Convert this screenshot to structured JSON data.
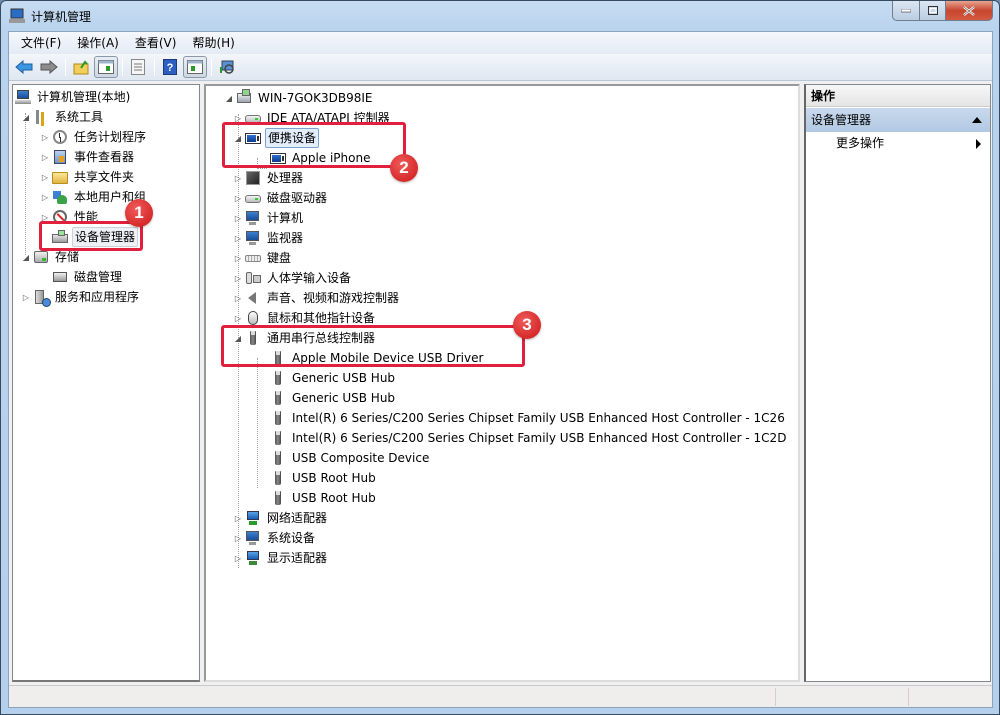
{
  "window": {
    "title": "计算机管理",
    "controls": {
      "minimize": "minimize",
      "maximize": "maximize",
      "close": "close"
    }
  },
  "menubar": {
    "items": [
      "文件(F)",
      "操作(A)",
      "查看(V)",
      "帮助(H)"
    ]
  },
  "toolbar": {
    "buttons": [
      {
        "icon": "back-arrow-icon"
      },
      {
        "icon": "forward-arrow-icon"
      },
      {
        "icon": "up-folder-icon"
      },
      {
        "icon": "show-hide-console-tree-icon",
        "pressed": true
      },
      {
        "icon": "properties-icon"
      },
      {
        "icon": "help-icon"
      },
      {
        "icon": "show-hide-action-pane-icon",
        "pressed": true
      },
      {
        "icon": "scan-hardware-icon"
      }
    ]
  },
  "left_tree": {
    "root": "计算机管理(本地)",
    "system_tools": "系统工具",
    "system_tools_children": [
      "任务计划程序",
      "事件查看器",
      "共享文件夹",
      "本地用户和组",
      "性能",
      "设备管理器"
    ],
    "storage": "存储",
    "storage_children": [
      "磁盘管理"
    ],
    "services": "服务和应用程序",
    "selected": "设备管理器"
  },
  "device_tree": {
    "root": "WIN-7GOK3DB98IE",
    "categories": [
      {
        "label": "IDE ATA/ATAPI 控制器",
        "expanded": false
      },
      {
        "label": "便携设备",
        "expanded": true,
        "children": [
          "Apple iPhone"
        ]
      },
      {
        "label": "处理器",
        "expanded": false
      },
      {
        "label": "磁盘驱动器",
        "expanded": false
      },
      {
        "label": "计算机",
        "expanded": false
      },
      {
        "label": "监视器",
        "expanded": false
      },
      {
        "label": "键盘",
        "expanded": false
      },
      {
        "label": "人体学输入设备",
        "expanded": false
      },
      {
        "label": "声音、视频和游戏控制器",
        "expanded": false
      },
      {
        "label": "鼠标和其他指针设备",
        "expanded": false
      },
      {
        "label": "通用串行总线控制器",
        "expanded": true,
        "children": [
          "Apple Mobile Device USB Driver",
          "Generic USB Hub",
          "Generic USB Hub",
          "Intel(R) 6 Series/C200 Series Chipset Family USB Enhanced Host Controller - 1C26",
          "Intel(R) 6 Series/C200 Series Chipset Family USB Enhanced Host Controller - 1C2D",
          "USB Composite Device",
          "USB Root Hub",
          "USB Root Hub"
        ]
      },
      {
        "label": "网络适配器",
        "expanded": false
      },
      {
        "label": "系统设备",
        "expanded": false
      },
      {
        "label": "显示适配器",
        "expanded": false
      }
    ]
  },
  "action_pane": {
    "header": "操作",
    "section": "设备管理器",
    "items": [
      "更多操作"
    ]
  },
  "annotations": {
    "badges": [
      "1",
      "2",
      "3"
    ],
    "highlight_color": "#e0203c"
  }
}
